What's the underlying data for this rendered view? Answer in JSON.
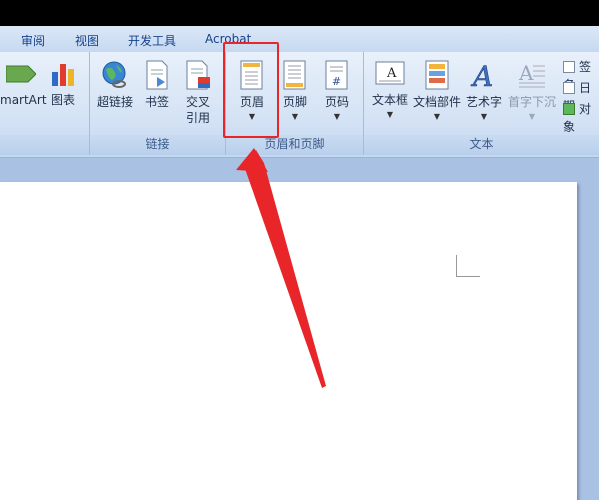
{
  "tabs": [
    "审阅",
    "视图",
    "开发工具",
    "Acrobat"
  ],
  "ribbon": {
    "partial_group": {
      "buttons": [
        {
          "label": "martArt",
          "icon": "smartart-icon"
        },
        {
          "label": "图表",
          "icon": "chart-icon"
        }
      ]
    },
    "links_group": {
      "label": "链接",
      "buttons": [
        {
          "label": "超链接",
          "icon": "hyperlink-globe-icon"
        },
        {
          "label": "书签",
          "icon": "bookmark-icon"
        },
        {
          "label_line1": "交叉",
          "label_line2": "引用",
          "icon": "cross-reference-icon"
        }
      ]
    },
    "header_footer_group": {
      "label": "页眉和页脚",
      "buttons": [
        {
          "label": "页眉",
          "icon": "header-page-icon",
          "highlighted": true
        },
        {
          "label": "页脚",
          "icon": "footer-page-icon"
        },
        {
          "label": "页码",
          "icon": "page-number-icon",
          "glyph": "#"
        }
      ]
    },
    "text_group": {
      "label": "文本",
      "buttons": [
        {
          "label": "文本框",
          "icon": "textbox-icon",
          "glyph": "A"
        },
        {
          "label": "文档部件",
          "icon": "quick-parts-icon"
        },
        {
          "label": "艺术字",
          "icon": "wordart-icon",
          "glyph": "A"
        },
        {
          "label": "首字下沉",
          "icon": "drop-cap-icon",
          "glyph": "A",
          "disabled": true
        }
      ],
      "small_items": [
        {
          "label": "签名",
          "icon": "signature-line-icon"
        },
        {
          "label": "日期",
          "icon": "date-time-icon"
        },
        {
          "label": "对象",
          "icon": "object-icon"
        }
      ]
    }
  },
  "colors": {
    "highlight": "#e8262a",
    "arrow": "#e8262a",
    "ribbon_text": "#1e2f4a",
    "tab_text": "#15428b"
  }
}
